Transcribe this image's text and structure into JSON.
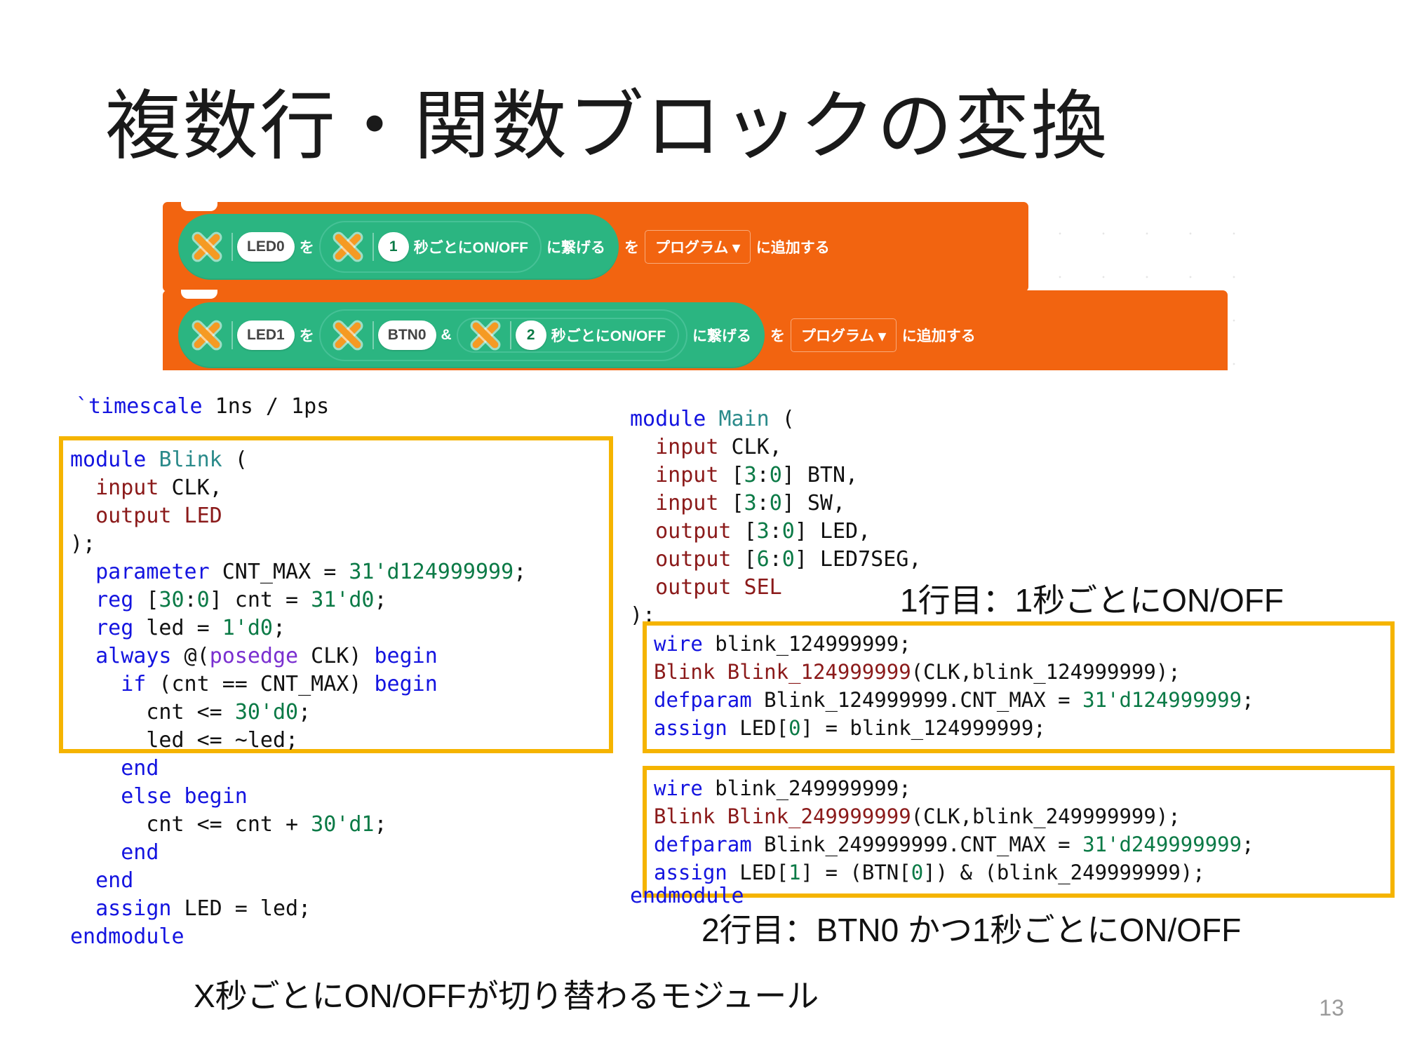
{
  "slide": {
    "title": "複数行・関数ブロックの変換",
    "page_number": "13"
  },
  "block_editor": {
    "blocks": [
      {
        "id": "block-1",
        "icon": "x-icon",
        "target": "LED0",
        "particle_wo": "を",
        "inner_icon": "x-icon",
        "interval": "1",
        "inner_label": "秒ごとにON/OFF",
        "connect_label": "に繋げる",
        "particle_wo_2": "を",
        "dropdown": "プログラム",
        "dropdown_caret": "▾",
        "add_label": "に追加する"
      },
      {
        "id": "block-2",
        "icon": "x-icon",
        "target": "LED1",
        "particle_wo": "を",
        "cond_icon": "x-icon",
        "cond_value": "BTN0",
        "amp": "&",
        "inner_icon": "x-icon",
        "interval": "2",
        "inner_label": "秒ごとにON/OFF",
        "connect_label": "に繋げる",
        "particle_wo_2": "を",
        "dropdown": "プログラム",
        "dropdown_caret": "▾",
        "add_label": "に追加する"
      }
    ]
  },
  "left_code": {
    "timescale_line": {
      "directive": "`timescale",
      "rest": " 1ns / 1ps"
    },
    "lines": [
      "module Blink (",
      "  input CLK,",
      "  output LED",
      ");",
      "  parameter CNT_MAX = 31'd124999999;",
      "  reg [30:0] cnt = 31'd0;",
      "  reg led = 1'd0;",
      "  always @(posedge CLK) begin",
      "    if (cnt == CNT_MAX) begin",
      "      cnt <= 30'd0;",
      "      led <= ~led;",
      "    end",
      "    else begin",
      "      cnt <= cnt + 30'd1;",
      "    end",
      "  end",
      "  assign LED = led;",
      "endmodule"
    ],
    "caption": "X秒ごとにON/OFFが切り替わるモジュール"
  },
  "right_code": {
    "header_lines": [
      "module Main (",
      "  input CLK,",
      "  input [3:0] BTN,",
      "  input [3:0] SW,",
      "  output [3:0] LED,",
      "  output [6:0] LED7SEG,",
      "  output SEL",
      ");"
    ],
    "box1": {
      "annotation": "1行目：1秒ごとにON/OFF",
      "lines": [
        "wire blink_124999999;",
        "Blink Blink_124999999(CLK,blink_124999999);",
        "defparam Blink_124999999.CNT_MAX = 31'd124999999;",
        "assign LED[0] = blink_124999999;"
      ]
    },
    "box2": {
      "annotation": "2行目：BTN0 かつ1秒ごとにON/OFF",
      "lines": [
        "wire blink_249999999;",
        "Blink Blink_249999999(CLK,blink_249999999);",
        "defparam Blink_249999999.CNT_MAX = 31'd249999999;",
        "assign LED[1] = (BTN[0]) & (blink_249999999);"
      ]
    },
    "footer_line": "endmodule"
  },
  "colors": {
    "block_stack": "#F26410",
    "block_reporter": "#2BB581",
    "icon_orange": "#F59A23",
    "highlight_border": "#F5B400",
    "keyword": "#1414e0",
    "module_name": "#2a8a8a",
    "number": "#0b7a46",
    "port": "#8b1a1a"
  }
}
